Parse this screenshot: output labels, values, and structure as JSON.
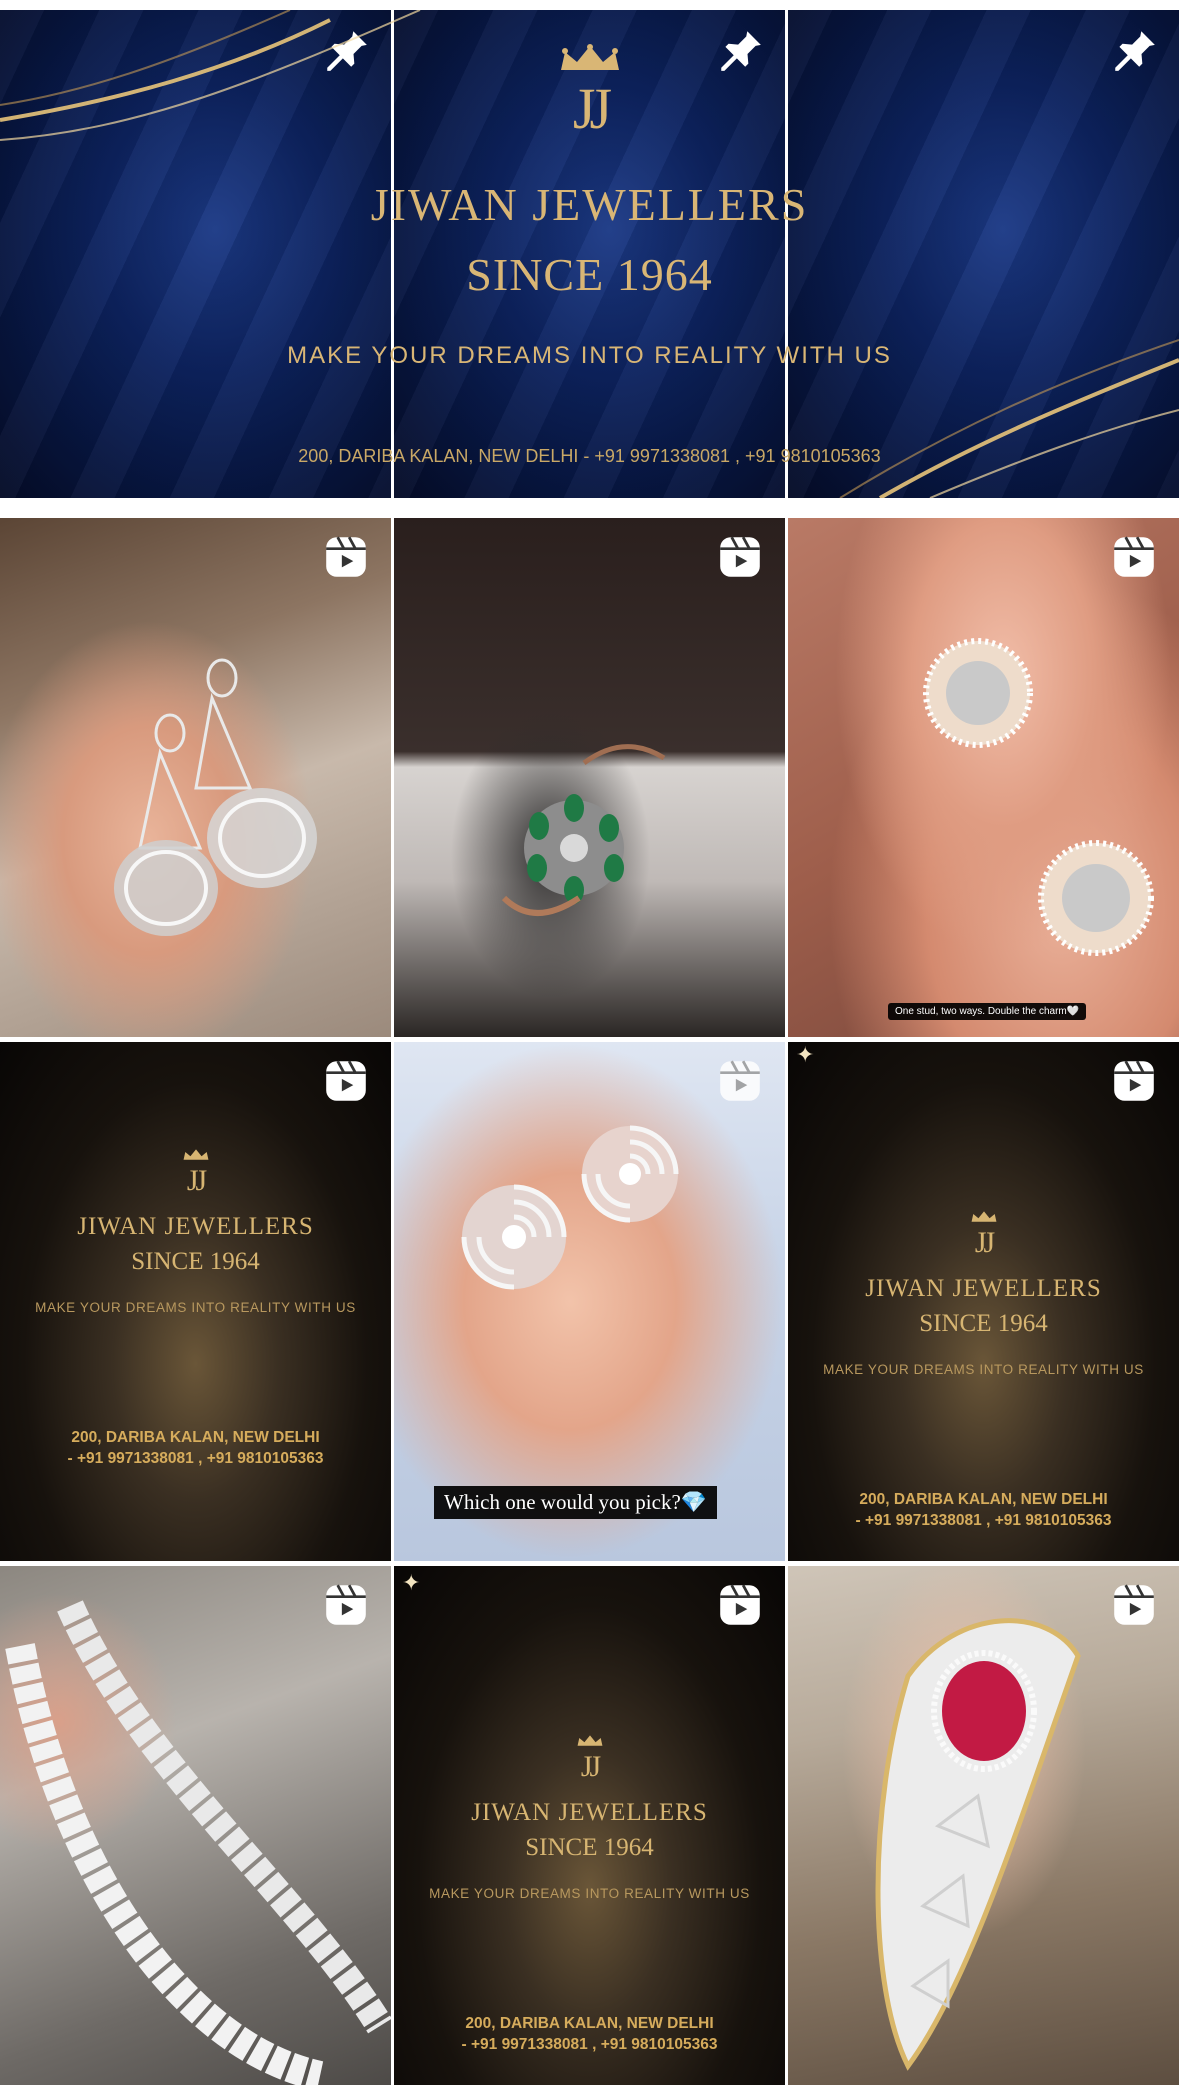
{
  "pinned_banner": {
    "logo_text": "JJ",
    "title": "JIWAN JEWELLERS",
    "since": "SINCE 1964",
    "tagline": "MAKE YOUR DREAMS INTO REALITY WITH US",
    "address_line": "200, DARIBA KALAN, NEW DELHI - +91 9971338081 ,  +91 9810105363"
  },
  "brand_tile": {
    "logo_text": "JJ",
    "title": "JIWAN JEWELLERS",
    "since": "SINCE 1964",
    "tagline": "MAKE YOUR DREAMS INTO REALITY WITH US",
    "address_1": "200, DARIBA KALAN, NEW DELHI",
    "address_2": "- +91 9971338081 ,  +91 9810105363"
  },
  "captions": {
    "studs": "One stud, two ways. Double the charm🤍",
    "floral": "Which one would you pick?💎"
  },
  "icons": {
    "pinned": "pin-icon",
    "reel": "reel-icon"
  },
  "colors": {
    "gold": "#d9b675",
    "navy": "#0d2360"
  }
}
